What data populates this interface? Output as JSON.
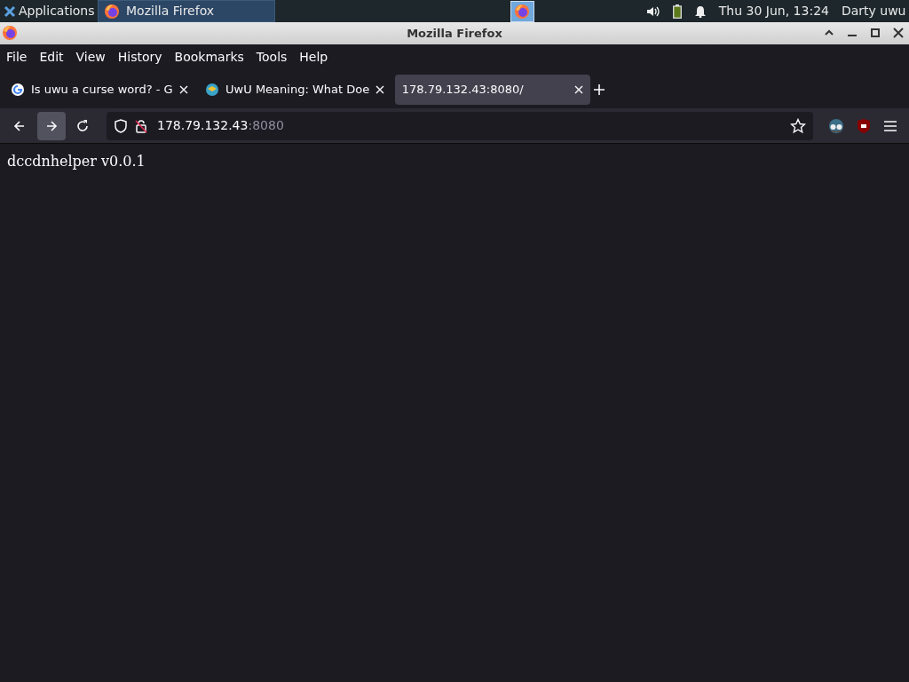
{
  "taskbar": {
    "apps_menu": "Applications",
    "tasks": [
      {
        "title": "Mozilla Firefox",
        "selected": true
      }
    ],
    "clock": "Thu 30 Jun, 13:24",
    "user": "Darty uwu"
  },
  "window": {
    "title": "Mozilla Firefox"
  },
  "menu": [
    "File",
    "Edit",
    "View",
    "History",
    "Bookmarks",
    "Tools",
    "Help"
  ],
  "tabs": [
    {
      "title": "Is uwu a curse word? - G",
      "kind": "google",
      "selected": false
    },
    {
      "title": "UwU Meaning: What Doe",
      "kind": "globe",
      "selected": false
    },
    {
      "title": "178.79.132.43:8080/",
      "kind": "plain",
      "selected": true
    }
  ],
  "nav_buttons": [
    {
      "kind": "back",
      "highlighted": false
    },
    {
      "kind": "forward",
      "highlighted": true
    },
    {
      "kind": "reload",
      "highlighted": false
    }
  ],
  "address": {
    "host": "178.79.132.43",
    "port": ":8080"
  },
  "page": {
    "text": "dccdnhelper v0.0.1"
  }
}
